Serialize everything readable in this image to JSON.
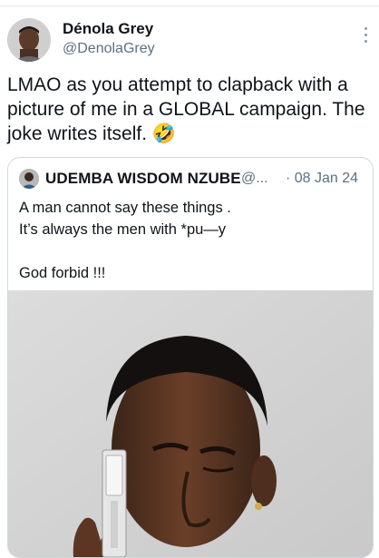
{
  "tweet": {
    "display_name": "Dénola Grey",
    "handle": "@DenolaGrey",
    "text_lines": [
      "LMAO as you attempt to clapback with a",
      "picture of me in a GLOBAL campaign. The",
      "joke writes itself. 🤣"
    ]
  },
  "quoted_tweet": {
    "display_name": "UDEMBA WISDOM NZUBE",
    "handle": "@...",
    "separator_date": "· 08 Jan 24",
    "text_lines": [
      "A man cannot say these things .",
      "It’s always the men with *pu—y",
      "",
      "God forbid !!!"
    ]
  },
  "icons": {
    "more": "more-vertical-icon"
  },
  "colors": {
    "secondary_text": "#5b7083",
    "border": "#cfd9de"
  }
}
